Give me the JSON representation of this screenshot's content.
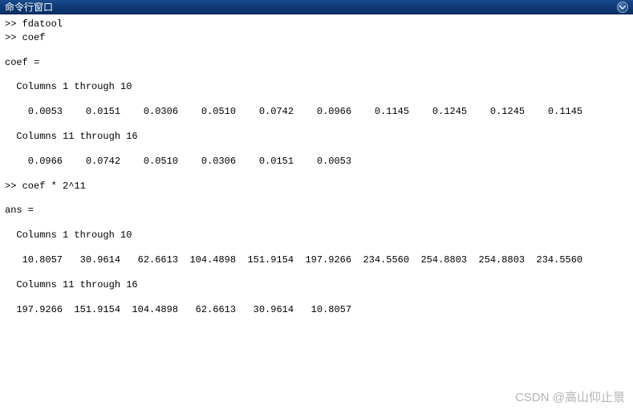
{
  "titlebar": {
    "title": "命令行窗口",
    "menu_icon": "menu-icon"
  },
  "watermark": "CSDN @高山仰止景",
  "console": {
    "lines": [
      ">> fdatool",
      ">> coef",
      "",
      "coef =",
      "",
      "  Columns 1 through 10",
      "",
      "    0.0053    0.0151    0.0306    0.0510    0.0742    0.0966    0.1145    0.1245    0.1245    0.1145",
      "",
      "  Columns 11 through 16",
      "",
      "    0.0966    0.0742    0.0510    0.0306    0.0151    0.0053",
      "",
      ">> coef * 2^11",
      "",
      "ans =",
      "",
      "  Columns 1 through 10",
      "",
      "   10.8057   30.9614   62.6613  104.4898  151.9154  197.9266  234.5560  254.8803  254.8803  234.5560",
      "",
      "  Columns 11 through 16",
      "",
      "  197.9266  151.9154  104.4898   62.6613   30.9614   10.8057"
    ]
  }
}
